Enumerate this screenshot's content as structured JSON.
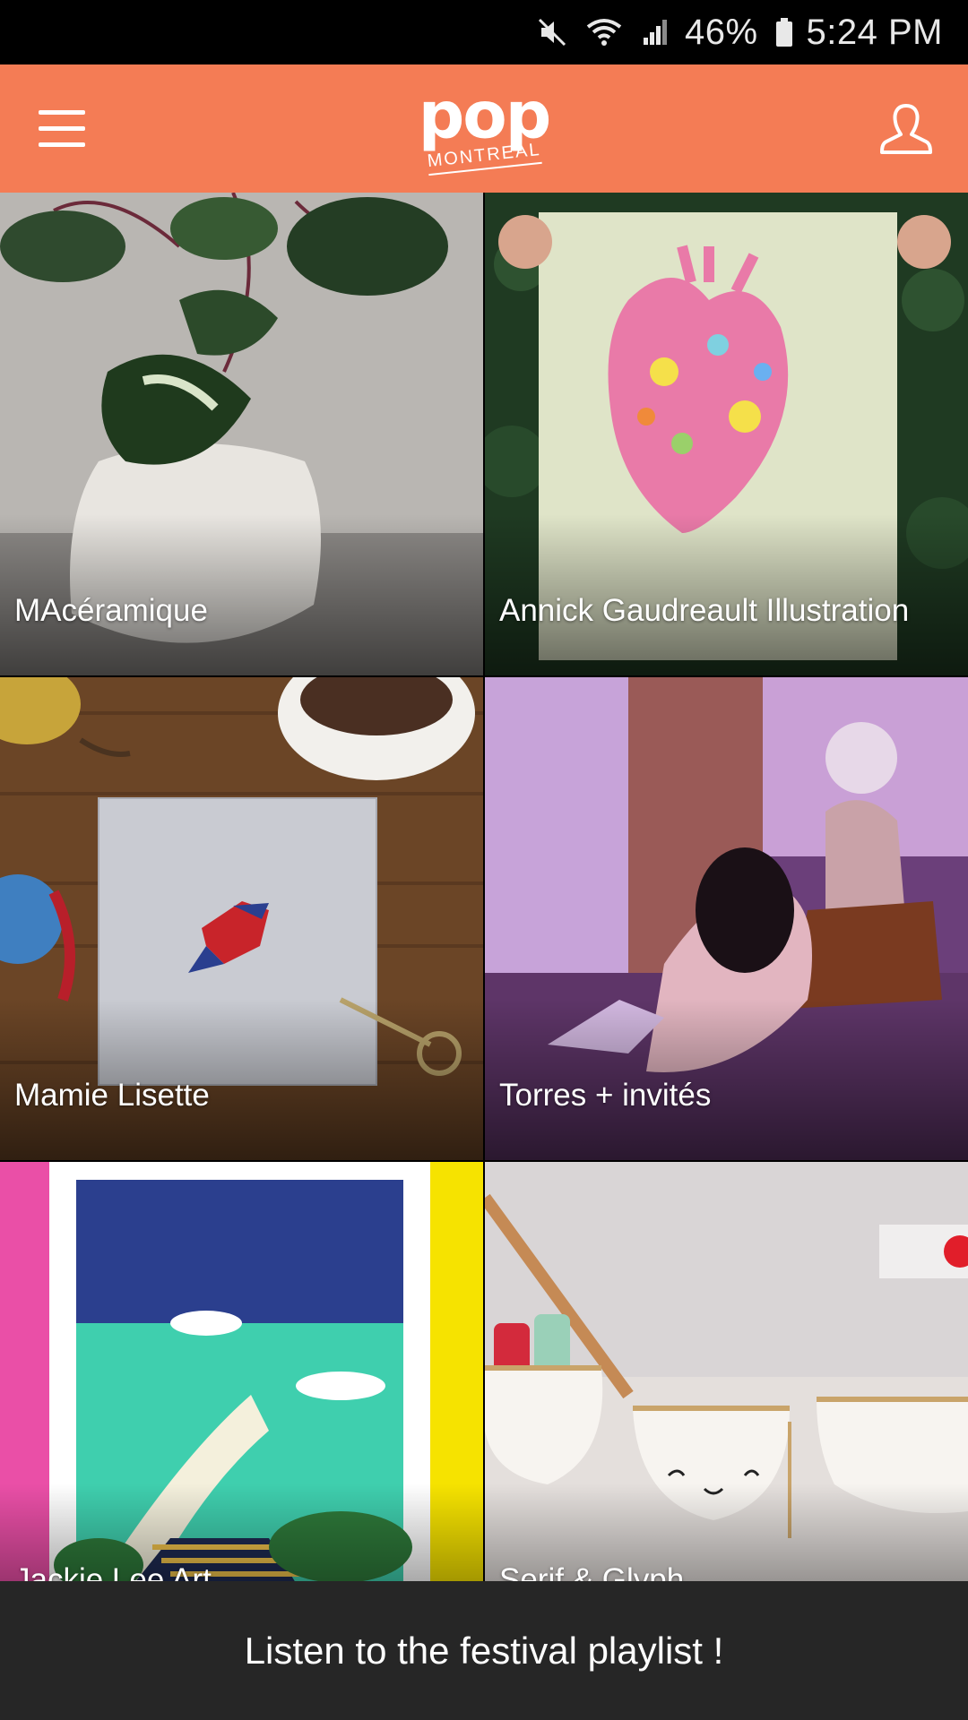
{
  "status_bar": {
    "battery": "46%",
    "time": "5:24 PM",
    "icons": [
      "mute-icon",
      "wifi-icon",
      "signal-icon",
      "battery-icon"
    ]
  },
  "app_bar": {
    "logo_main": "pop",
    "logo_sub": "MONTREAL",
    "background": "#F47C55",
    "icons": [
      "menu-icon",
      "profile-icon"
    ]
  },
  "tiles": [
    {
      "label": "MAcéramique"
    },
    {
      "label": "Annick Gaudreault Illustration"
    },
    {
      "label": "Mamie Lisette"
    },
    {
      "label": "Torres + invités"
    },
    {
      "label": "Jackie Lee Art"
    },
    {
      "label": "Serif & Glyph"
    }
  ],
  "bottom_banner": {
    "text": "Listen to the festival playlist !"
  }
}
